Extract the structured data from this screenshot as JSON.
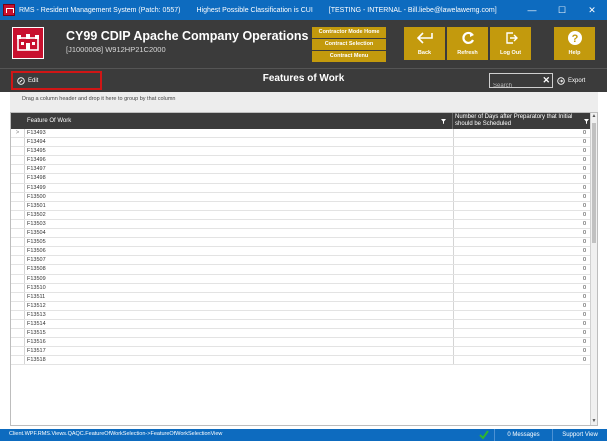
{
  "window": {
    "app_title": "RMS - Resident Management System (Patch: 0557)",
    "classification": "Highest Possible Classification is CUI",
    "environment": "[TESTING - INTERNAL - Bill.liebe@lawelawemg.com]",
    "minimize": "—",
    "maximize": "☐",
    "close": "✕"
  },
  "header": {
    "project_title": "CY99 CDIP Apache Company Operations",
    "project_sub": "[J1000008] W912HP21C2000",
    "mode_buttons": [
      "Contractor Mode Home",
      "Contract Selection",
      "Contract Menu"
    ],
    "tool_buttons": {
      "back": "Back",
      "refresh": "Refresh",
      "logout": "Log Out",
      "help": "Help"
    },
    "accent_color": "#c39a0d"
  },
  "toolbar": {
    "edit_label": "Edit",
    "page_title": "Features of Work",
    "search_placeholder": "Search",
    "search_clear": "✕",
    "export_label": "Export"
  },
  "grid": {
    "group_hint": "Drag a column header and drop it here to group by that column",
    "columns": [
      "Feature Of Work",
      "Number of Days after Preparatory that Initial should be Scheduled"
    ],
    "rows": [
      {
        "feature": "F13493",
        "days": "0"
      },
      {
        "feature": "F13494",
        "days": "0"
      },
      {
        "feature": "F13495",
        "days": "0"
      },
      {
        "feature": "F13496",
        "days": "0"
      },
      {
        "feature": "F13497",
        "days": "0"
      },
      {
        "feature": "F13498",
        "days": "0"
      },
      {
        "feature": "F13499",
        "days": "0"
      },
      {
        "feature": "F13500",
        "days": "0"
      },
      {
        "feature": "F13501",
        "days": "0"
      },
      {
        "feature": "F13502",
        "days": "0"
      },
      {
        "feature": "F13503",
        "days": "0"
      },
      {
        "feature": "F13504",
        "days": "0"
      },
      {
        "feature": "F13505",
        "days": "0"
      },
      {
        "feature": "F13506",
        "days": "0"
      },
      {
        "feature": "F13507",
        "days": "0"
      },
      {
        "feature": "F13508",
        "days": "0"
      },
      {
        "feature": "F13509",
        "days": "0"
      },
      {
        "feature": "F13510",
        "days": "0"
      },
      {
        "feature": "F13511",
        "days": "0"
      },
      {
        "feature": "F13512",
        "days": "0"
      },
      {
        "feature": "F13513",
        "days": "0"
      },
      {
        "feature": "F13514",
        "days": "0"
      },
      {
        "feature": "F13515",
        "days": "0"
      },
      {
        "feature": "F13516",
        "days": "0"
      },
      {
        "feature": "F13517",
        "days": "0"
      },
      {
        "feature": "F13518",
        "days": "0"
      }
    ],
    "selected_row_marker": ">"
  },
  "statusbar": {
    "view_path": "Client.WPF.RMS.Views.QAQC.FeatureOfWorkSelection->FeatureOfWorkSelectionView",
    "messages": "0 Messages",
    "support": "Support View"
  },
  "icons": {
    "app": "rms-logo-icon",
    "logo": "castle-icon",
    "back": "back-arrow-icon",
    "refresh": "refresh-icon",
    "logout": "logout-icon",
    "help": "help-icon",
    "edit": "edit-icon",
    "export": "export-icon",
    "filter": "filter-icon",
    "status": "check-icon"
  }
}
